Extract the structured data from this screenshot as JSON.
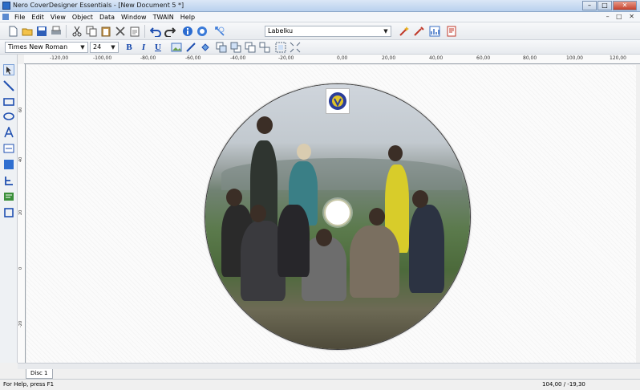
{
  "window": {
    "title": "Nero CoverDesigner Essentials - [New Document 5 *]",
    "controls": [
      "–",
      "□",
      "✕"
    ]
  },
  "menu": {
    "items": [
      "File",
      "Edit",
      "View",
      "Object",
      "Data",
      "Window",
      "TWAIN",
      "Help"
    ],
    "mdi_controls": "– □ ✕"
  },
  "toolbar": {
    "icons": [
      "new-icon",
      "open-icon",
      "save-icon",
      "print-icon",
      "cut-icon",
      "copy-icon",
      "paste-icon",
      "delete-icon",
      "clipboard-icon",
      "undo-icon",
      "redo-icon",
      "info-icon",
      "help-icon",
      "properties-icon"
    ],
    "label_combo": "Labelku",
    "right_icons": [
      "magic-wand-icon",
      "wizard-icon",
      "chart-icon",
      "print-preview-icon"
    ]
  },
  "format": {
    "font": "Times New Roman",
    "size": "24",
    "bold": "B",
    "italic": "I",
    "underline": "U"
  },
  "ruler": {
    "h_ticks": [
      "-120,00",
      "-100,00",
      "-80,00",
      "-60,00",
      "-40,00",
      "-20,00",
      "0,00",
      "20,00",
      "40,00",
      "60,00",
      "80,00",
      "100,00",
      "120,00"
    ],
    "v_ticks": [
      "60",
      "40",
      "20",
      "0",
      "-20",
      "-40",
      "-60"
    ]
  },
  "document": {
    "tab_label": "Disc 1"
  },
  "status": {
    "help": "For Help, press F1",
    "coords": "104,00 / -19,30"
  },
  "colors": {
    "title_bar": "#c6d9f0",
    "canvas": "#fbfbfb",
    "accent": "#1f4fb0"
  }
}
